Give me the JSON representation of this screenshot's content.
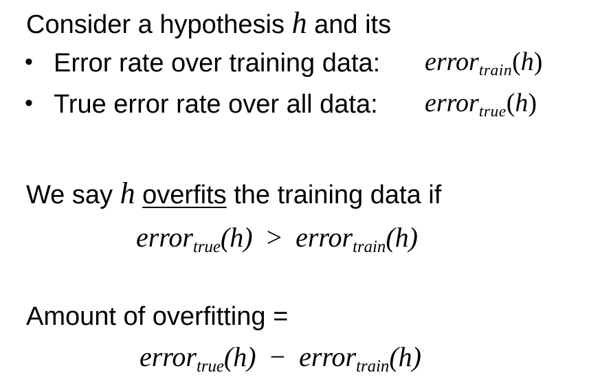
{
  "intro": {
    "text": "Consider a hypothesis",
    "var": "h",
    "tail": "and its"
  },
  "bullets": [
    {
      "symbol": "•",
      "text": "Error rate over training data:",
      "func": "error",
      "sub": "train",
      "arg_open": "(",
      "arg": "h",
      "arg_close": ")"
    },
    {
      "symbol": "•",
      "text": "True error rate over all data:",
      "func": "error",
      "sub": "true",
      "arg_open": "(",
      "arg": "h",
      "arg_close": ")"
    }
  ],
  "overfit": {
    "text_a": "We say",
    "var": "h",
    "term": "overfits",
    "text_b": "the training data if"
  },
  "inequality": {
    "lhs_func": "error",
    "lhs_sub": "true",
    "lhs_arg": "(h)",
    "op": ">",
    "rhs_func": "error",
    "rhs_sub": "train",
    "rhs_arg": "(h)"
  },
  "amount": {
    "text": "Amount of overfitting ="
  },
  "difference": {
    "lhs_func": "error",
    "lhs_sub": "true",
    "lhs_arg": "(h)",
    "op": "−",
    "rhs_func": "error",
    "rhs_sub": "train",
    "rhs_arg": "(h)"
  }
}
